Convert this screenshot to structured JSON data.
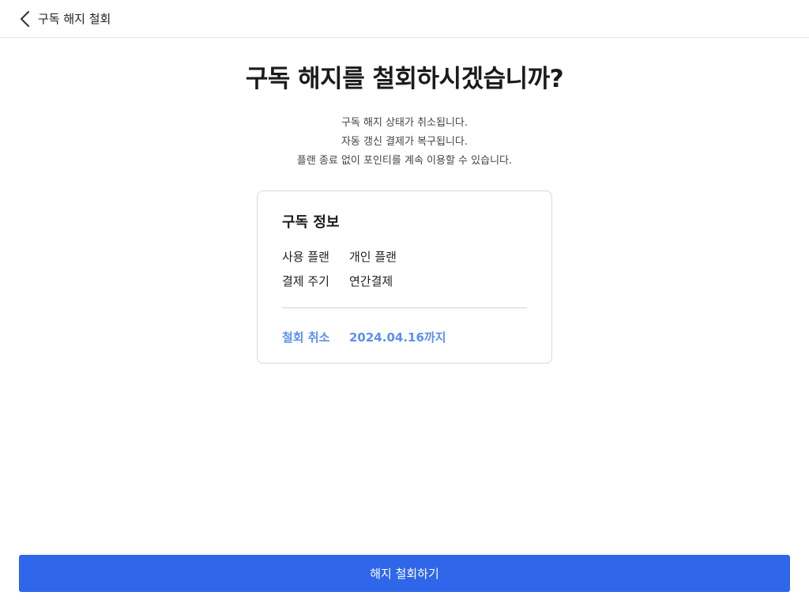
{
  "header": {
    "back_icon": "chevron-left-icon",
    "title": "구독 해지 철회"
  },
  "main": {
    "title": "구독 해지를 철회하시겠습니까?",
    "description": [
      "구독 해지 상태가 취소됩니다.",
      "자동 갱신 결제가 복구됩니다.",
      "플랜 종료 없이 포인티를 계속 이용할 수 있습니다."
    ]
  },
  "card": {
    "title": "구독 정보",
    "rows": [
      {
        "label": "사용 플랜",
        "value": "개인 플랜"
      },
      {
        "label": "결제 주기",
        "value": "연간결제"
      }
    ],
    "highlight": {
      "label": "철회 취소",
      "value": "2024.04.16까지",
      "color": "#5b8ff0"
    }
  },
  "cta": {
    "label": "해지 철회하기",
    "color": "#2f66ea"
  }
}
